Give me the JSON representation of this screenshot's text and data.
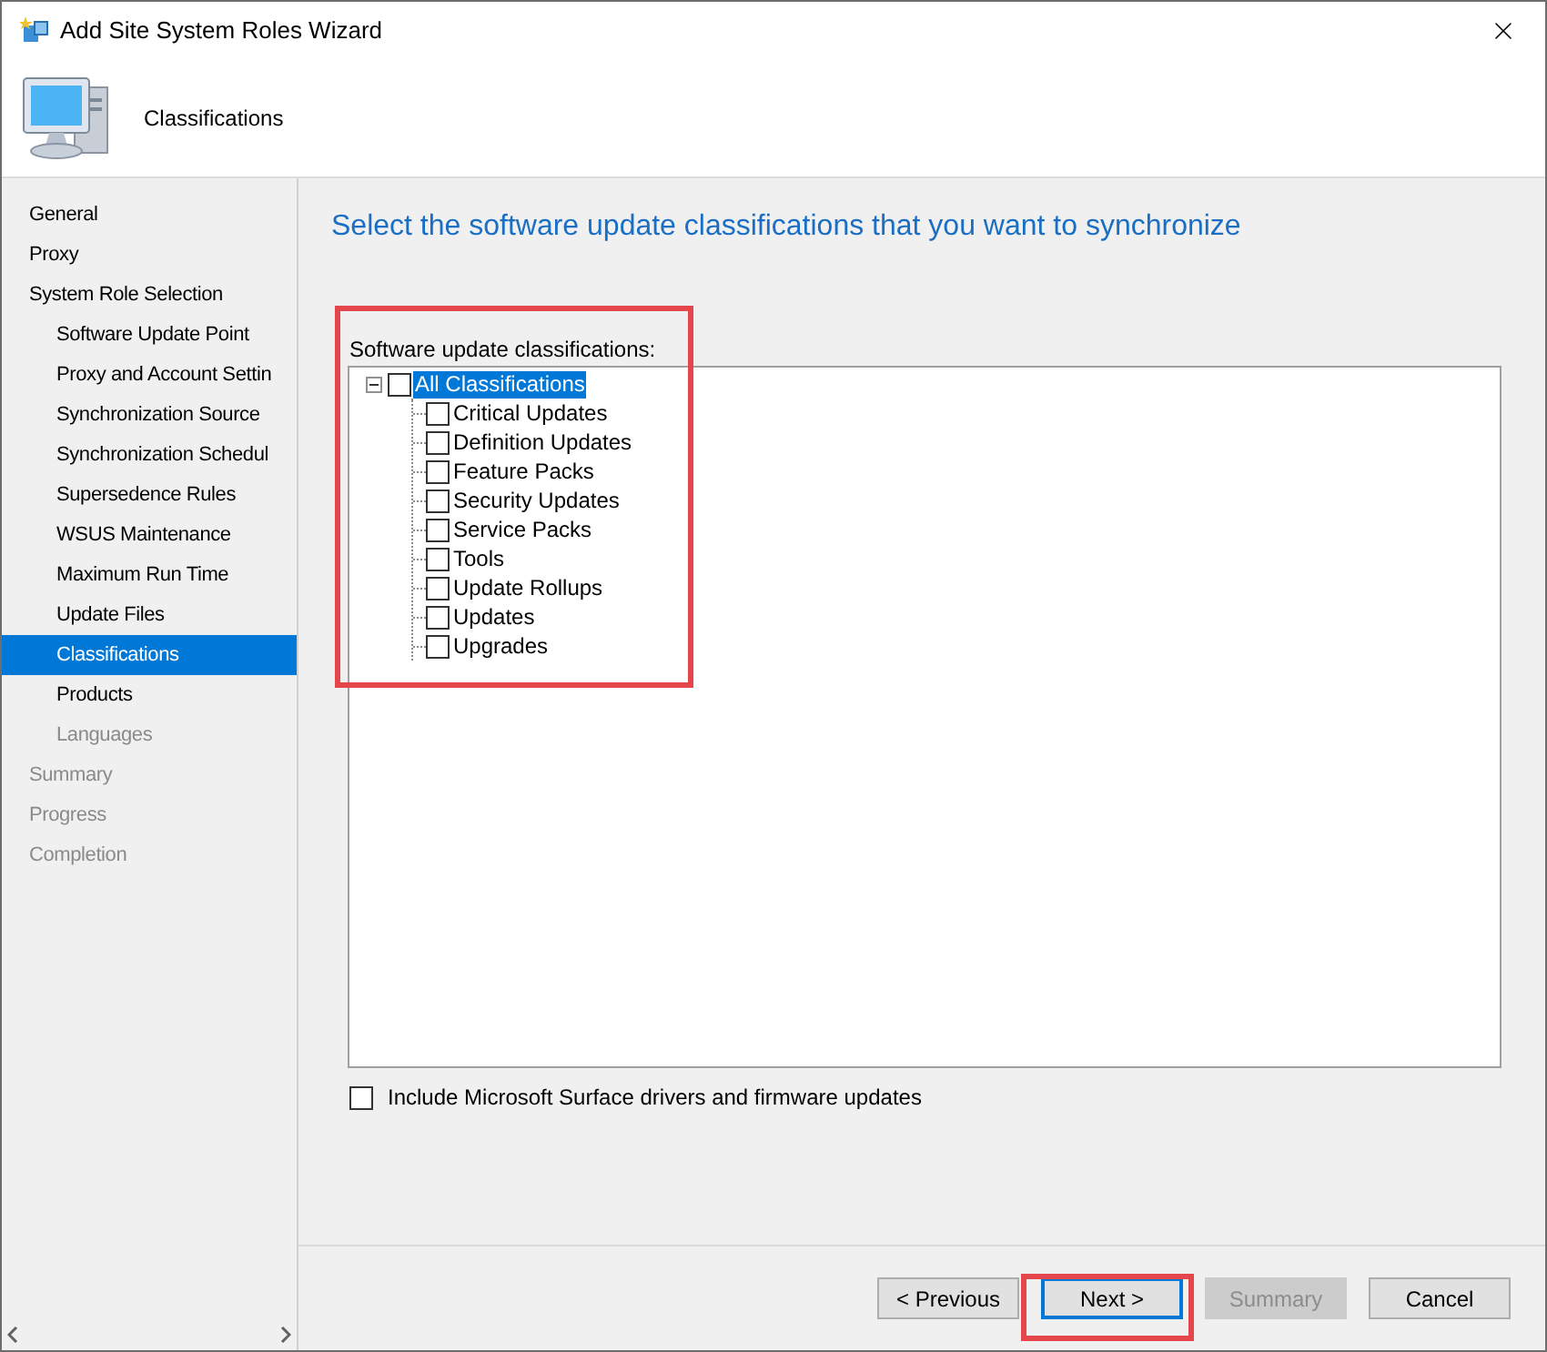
{
  "window": {
    "title": "Add Site System Roles Wizard"
  },
  "header": {
    "title": "Classifications"
  },
  "sidebar": {
    "items": [
      {
        "label": "General",
        "selected": false,
        "disabled": false
      },
      {
        "label": "Proxy",
        "selected": false,
        "disabled": false
      },
      {
        "label": "System Role Selection",
        "selected": false,
        "disabled": false,
        "children": [
          {
            "label": "Software Update Point",
            "selected": false,
            "disabled": false
          },
          {
            "label": "Proxy and Account Settin",
            "selected": false,
            "disabled": false
          },
          {
            "label": "Synchronization Source",
            "selected": false,
            "disabled": false
          },
          {
            "label": "Synchronization Schedul",
            "selected": false,
            "disabled": false
          },
          {
            "label": "Supersedence Rules",
            "selected": false,
            "disabled": false
          },
          {
            "label": "WSUS Maintenance",
            "selected": false,
            "disabled": false
          },
          {
            "label": "Maximum Run Time",
            "selected": false,
            "disabled": false
          },
          {
            "label": "Update Files",
            "selected": false,
            "disabled": false
          },
          {
            "label": "Classifications",
            "selected": true,
            "disabled": false
          },
          {
            "label": "Products",
            "selected": false,
            "disabled": false
          },
          {
            "label": "Languages",
            "selected": false,
            "disabled": true
          }
        ]
      },
      {
        "label": "Summary",
        "selected": false,
        "disabled": true
      },
      {
        "label": "Progress",
        "selected": false,
        "disabled": true
      },
      {
        "label": "Completion",
        "selected": false,
        "disabled": true
      }
    ]
  },
  "content": {
    "heading": "Select the software update classifications that you want to synchronize",
    "tree_label": "Software update classifications:",
    "tree": {
      "label": "All Classifications",
      "checked": false,
      "selected": true,
      "expanded": true,
      "children": [
        {
          "label": "Critical Updates",
          "checked": false
        },
        {
          "label": "Definition Updates",
          "checked": false
        },
        {
          "label": "Feature Packs",
          "checked": false
        },
        {
          "label": "Security Updates",
          "checked": false
        },
        {
          "label": "Service Packs",
          "checked": false
        },
        {
          "label": "Tools",
          "checked": false
        },
        {
          "label": "Update Rollups",
          "checked": false
        },
        {
          "label": "Updates",
          "checked": false
        },
        {
          "label": "Upgrades",
          "checked": false
        }
      ]
    },
    "surface_option": {
      "label": "Include Microsoft Surface drivers and firmware updates",
      "checked": false
    }
  },
  "buttons": [
    {
      "label": "< Previous",
      "disabled": false,
      "focused": false
    },
    {
      "label": "Next >",
      "disabled": false,
      "focused": true
    },
    {
      "label": "Summary",
      "disabled": true,
      "focused": false
    },
    {
      "label": "Cancel",
      "disabled": false,
      "focused": false
    }
  ]
}
